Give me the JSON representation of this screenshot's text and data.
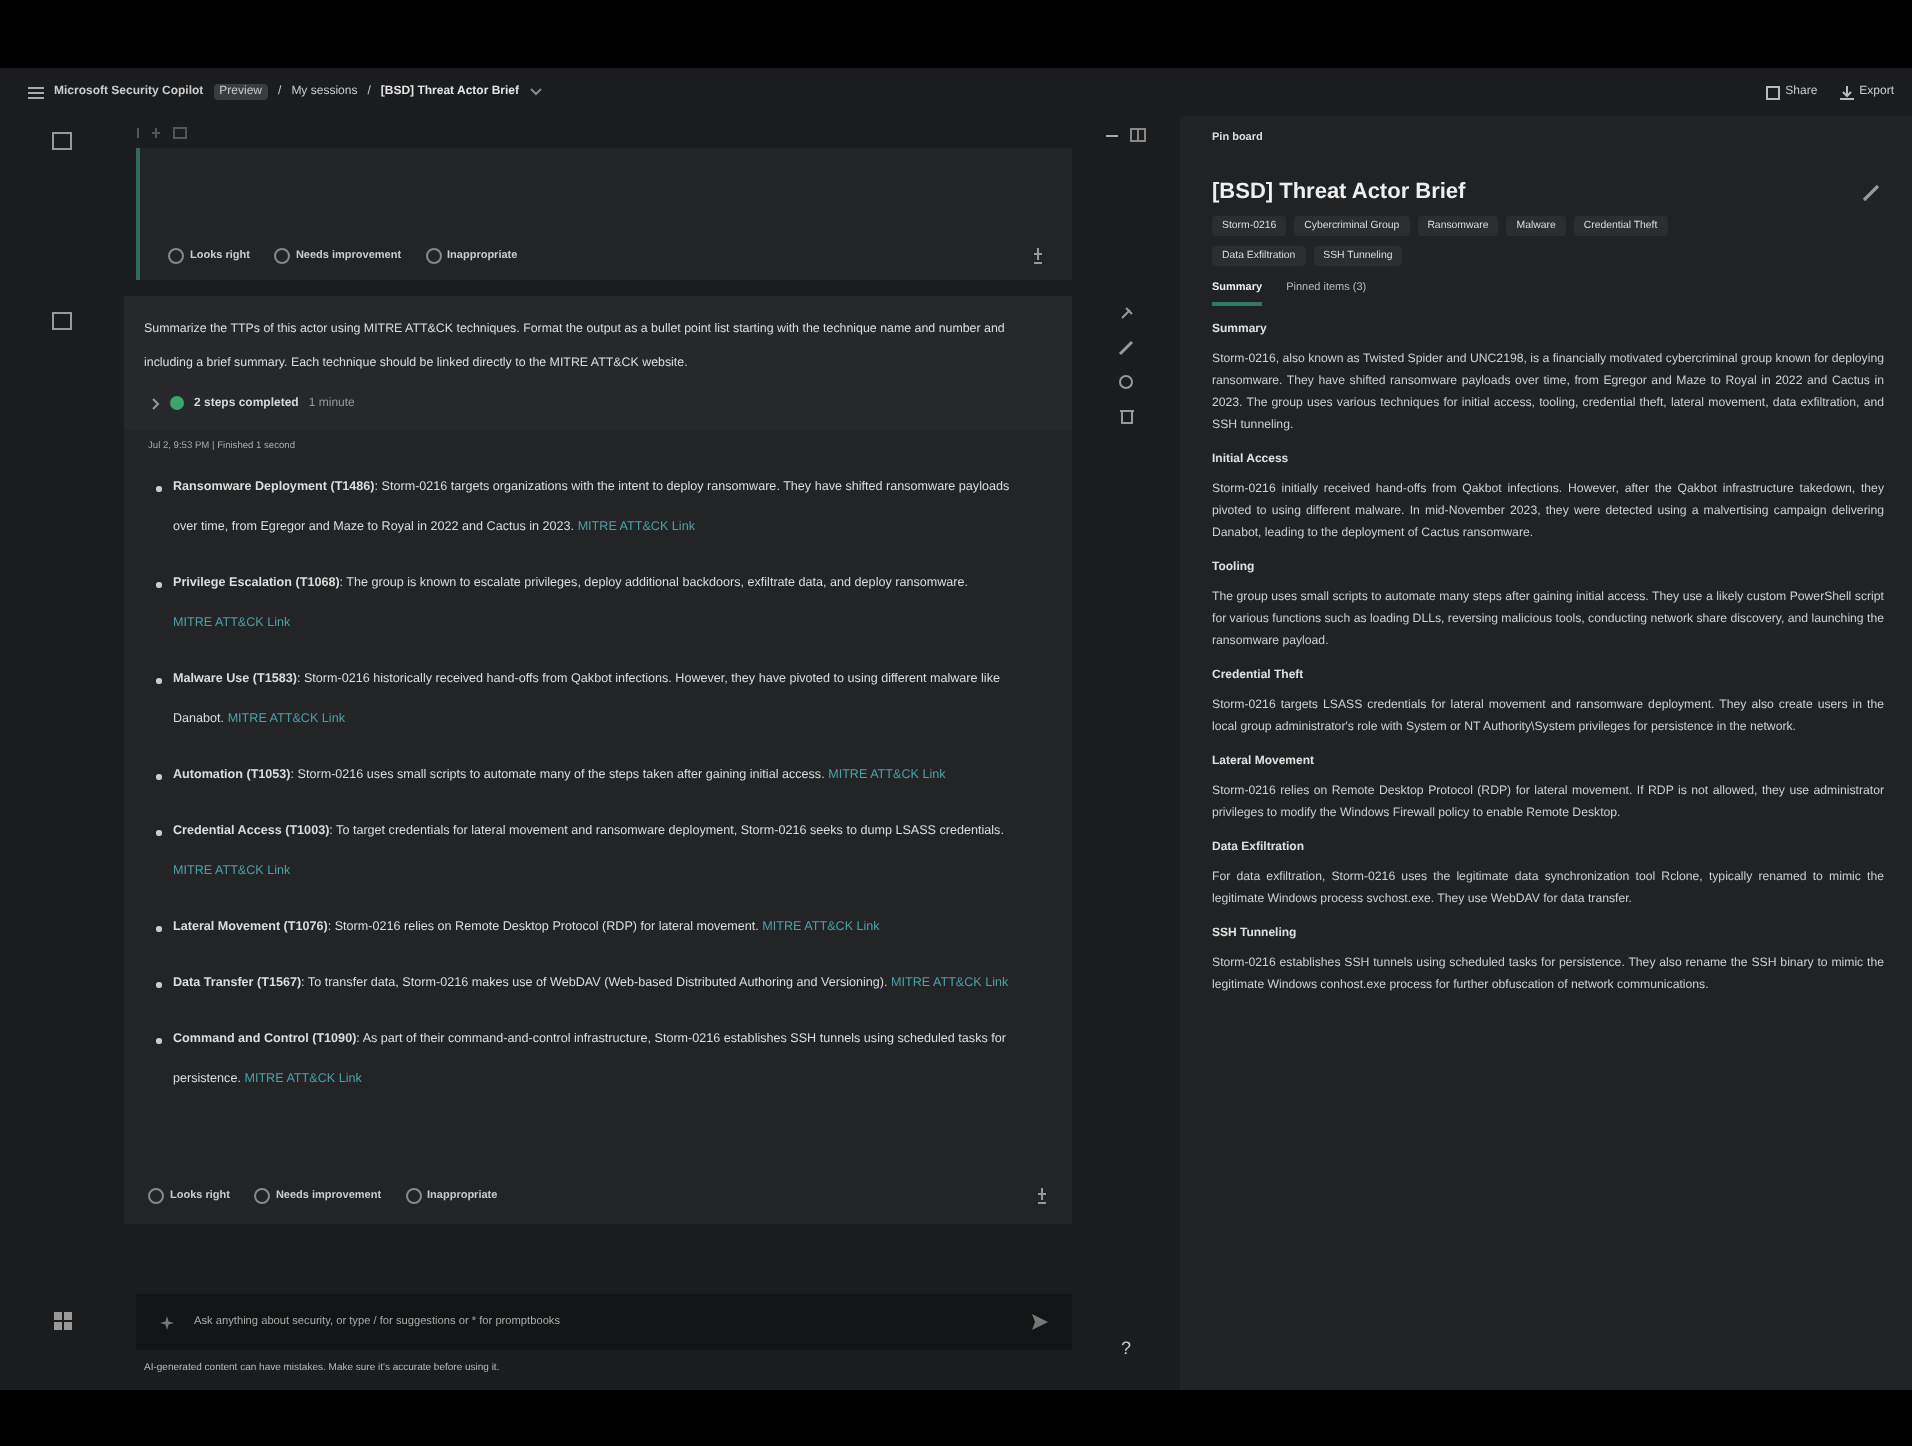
{
  "breadcrumb": [
    {
      "kind": "app",
      "text": "Microsoft Security Copilot"
    },
    {
      "kind": "badge",
      "text": "Preview"
    },
    {
      "kind": "separator",
      "text": "/"
    },
    {
      "kind": "link",
      "text": "My sessions"
    },
    {
      "kind": "separator",
      "text": "/"
    },
    {
      "kind": "current",
      "text": "[BSD] Threat Actor Brief"
    }
  ],
  "header_actions": [
    "Share",
    "Export"
  ],
  "previous_feedback": [
    "Looks right",
    "Needs improvement",
    "Inappropriate"
  ],
  "prompt": "Summarize the TTPs of this actor using MITRE ATT&CK techniques. Format the output as a bullet point list starting with the technique name and number and including a brief summary. Each technique should be linked directly to the MITRE ATT&CK website.",
  "steps": {
    "completed": true,
    "text": "2 steps completed",
    "duration": "1 minute"
  },
  "response_meta": "Jul 2, 9:53 PM | Finished 1 second",
  "techniques": [
    {
      "text": "**Ransomware Deployment (T1486)**: Storm-0216 targets organizations with the intent to deploy ransomware. They have shifted ransomware payloads over time, from Egregor and Maze to Royal in 2022 and Cactus in 2023.",
      "link": "MITRE ATT&CK Link"
    },
    {
      "text": "**Privilege Escalation (T1068)**: The group is known to escalate privileges, deploy additional backdoors, exfiltrate data, and deploy ransomware.",
      "link": "MITRE ATT&CK Link"
    },
    {
      "text": "**Malware Use (T1583)**: Storm-0216 historically received hand-offs from Qakbot infections. However, they have pivoted to using different malware like Danabot.",
      "link": "MITRE ATT&CK Link"
    },
    {
      "text": "**Automation (T1053)**: Storm-0216 uses small scripts to automate many of the steps taken after gaining initial access.",
      "link": "MITRE ATT&CK Link"
    },
    {
      "text": "**Credential Access (T1003)**: To target credentials for lateral movement and ransomware deployment, Storm-0216 seeks to dump LSASS credentials.",
      "link": "MITRE ATT&CK Link"
    },
    {
      "text": "**Lateral Movement (T1076)**: Storm-0216 relies on Remote Desktop Protocol (RDP) for lateral movement.",
      "link": "MITRE ATT&CK Link"
    },
    {
      "text": "**Data Transfer (T1567)**: To transfer data, Storm-0216 makes use of WebDAV (Web-based Distributed Authoring and Versioning).",
      "link": "MITRE ATT&CK Link"
    },
    {
      "text": "**Command and Control (T1090)**: As part of their command-and-control infrastructure, Storm-0216 establishes SSH tunnels using scheduled tasks for persistence.",
      "link": "MITRE ATT&CK Link"
    }
  ],
  "response_feedback": [
    "Looks right",
    "Needs improvement",
    "Inappropriate"
  ],
  "input": {
    "placeholder": "Ask anything about security, or type / for suggestions or * for promptbooks"
  },
  "disclaimer": "AI-generated content can have mistakes. Make sure it's accurate before using it.",
  "help": "?",
  "pinboard": {
    "label": "Pin board",
    "title": "[BSD] Threat Actor Brief",
    "tags": [
      "Storm-0216",
      "Cybercriminal Group",
      "Ransomware",
      "Malware",
      "Credential Theft",
      "Data Exfiltration",
      "SSH Tunneling"
    ],
    "tabs": [
      {
        "label": "Summary",
        "selected": true
      },
      {
        "label": "Pinned items (3)",
        "selected": false
      }
    ],
    "sections": [
      {
        "heading": "Summary",
        "text": "Storm-0216, also known as Twisted Spider and UNC2198, is a financially motivated cybercriminal group known for deploying ransomware. They have shifted ransomware payloads over time, from Egregor and Maze to Royal in 2022 and Cactus in 2023. The group uses various techniques for initial access, tooling, credential theft, lateral movement, data exfiltration, and SSH tunneling."
      },
      {
        "heading": "Initial Access",
        "text": "Storm-0216 initially received hand-offs from Qakbot infections. However, after the Qakbot infrastructure takedown, they pivoted to using different malware. In mid-November 2023, they were detected using a malvertising campaign delivering Danabot, leading to the deployment of Cactus ransomware."
      },
      {
        "heading": "Tooling",
        "text": "The group uses small scripts to automate many steps after gaining initial access. They use a likely custom PowerShell script for various functions such as loading DLLs, reversing malicious tools, conducting network share discovery, and launching the ransomware payload."
      },
      {
        "heading": "Credential Theft",
        "text": "Storm-0216 targets LSASS credentials for lateral movement and ransomware deployment. They also create users in the local group administrator's role with System or NT Authority\\System privileges for persistence in the network."
      },
      {
        "heading": "Lateral Movement",
        "text": "Storm-0216 relies on Remote Desktop Protocol (RDP) for lateral movement. If RDP is not allowed, they use administrator privileges to modify the Windows Firewall policy to enable Remote Desktop."
      },
      {
        "heading": "Data Exfiltration",
        "text": "For data exfiltration, Storm-0216 uses the legitimate data synchronization tool Rclone, typically renamed to mimic the legitimate Windows process svchost.exe. They use WebDAV for data transfer."
      },
      {
        "heading": "SSH Tunneling",
        "text": "Storm-0216 establishes SSH tunnels using scheduled tasks for persistence. They also rename the SSH binary to mimic the legitimate Windows conhost.exe process for further obfuscation of network communications."
      }
    ]
  }
}
